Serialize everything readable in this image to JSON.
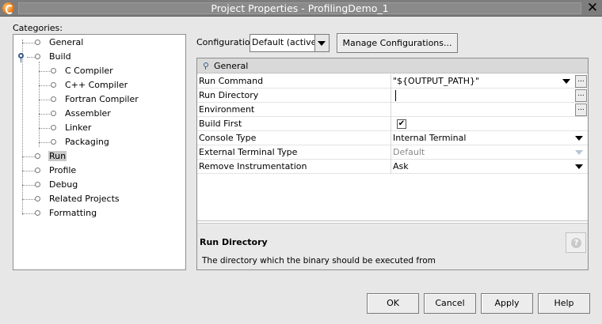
{
  "window": {
    "title": "Project Properties - ProfilingDemo_1",
    "icon": "app-icon",
    "close_icon": "close-icon"
  },
  "categories": {
    "label": "Categories:",
    "items": [
      {
        "label": "General"
      },
      {
        "label": "Build"
      },
      {
        "label": "C Compiler"
      },
      {
        "label": "C++ Compiler"
      },
      {
        "label": "Fortran Compiler"
      },
      {
        "label": "Assembler"
      },
      {
        "label": "Linker"
      },
      {
        "label": "Packaging"
      },
      {
        "label": "Run",
        "selected": true
      },
      {
        "label": "Profile"
      },
      {
        "label": "Debug"
      },
      {
        "label": "Related Projects"
      },
      {
        "label": "Formatting"
      }
    ]
  },
  "configuration": {
    "label": "Configuration:",
    "selected": "Default (active)",
    "manage_button": "Manage Configurations..."
  },
  "properties": {
    "group": "General",
    "rows": [
      {
        "name": "Run Command",
        "value": "\"${OUTPUT_PATH}\""
      },
      {
        "name": "Run Directory",
        "value": ""
      },
      {
        "name": "Environment",
        "value": ""
      },
      {
        "name": "Build First",
        "value": "✔"
      },
      {
        "name": "Console Type",
        "value": "Internal Terminal"
      },
      {
        "name": "External Terminal Type",
        "value": "Default"
      },
      {
        "name": "Remove Instrumentation",
        "value": "Ask"
      }
    ],
    "ellipsis": "...",
    "description": {
      "title": "Run Directory",
      "text": "The directory which the binary should be executed from",
      "help_icon": "?"
    }
  },
  "buttons": {
    "ok": "OK",
    "cancel": "Cancel",
    "apply": "Apply",
    "help": "Help"
  }
}
